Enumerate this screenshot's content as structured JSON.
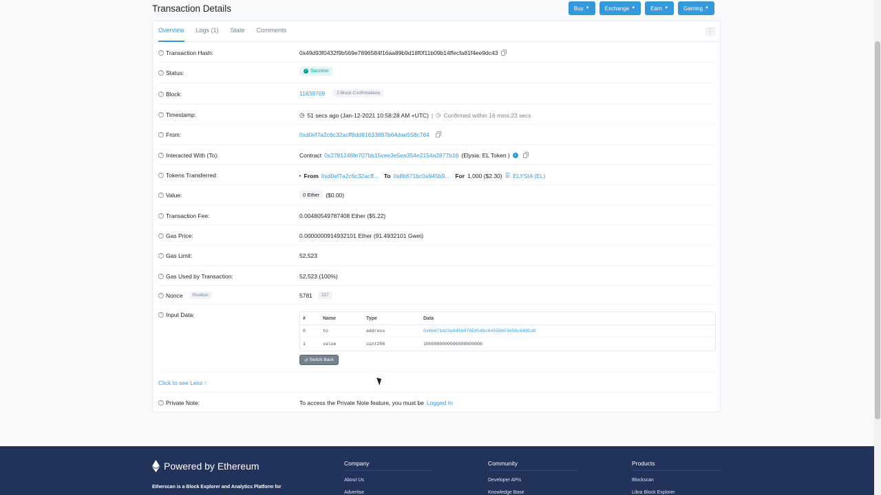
{
  "page_title": "Transaction Details",
  "top_buttons": [
    {
      "label": "Buy"
    },
    {
      "label": "Exchange"
    },
    {
      "label": "Earn"
    },
    {
      "label": "Gaming"
    }
  ],
  "tabs": [
    {
      "label": "Overview",
      "active": true
    },
    {
      "label": "Logs (1)"
    },
    {
      "label": "State"
    },
    {
      "label": "Comments"
    }
  ],
  "details": {
    "tx_hash": {
      "label": "Transaction Hash:",
      "value": "0x49d93f0432f9b569e7896584f16aa89b9d18f0f11b09b14ffecfa81f4ee9dc43"
    },
    "status": {
      "label": "Status:",
      "value": "Success"
    },
    "block": {
      "label": "Block:",
      "value": "11639709",
      "confirmations": "2 Block Confirmations"
    },
    "timestamp": {
      "label": "Timestamp:",
      "value": "51 secs ago (Jan-12-2021 10:58:28 AM +UTC)",
      "separator": "|",
      "confirmed": "Confirmed within 16 mins:23 secs"
    },
    "from": {
      "label": "From:",
      "value": "0xd0ef7a2c6c32acff8dd81633897b64dae558c764"
    },
    "interacted": {
      "label": "Interacted With (To):",
      "prefix": "Contract",
      "address": "0x2781246fe707bb15cee3e5ea354e2154a2877b16",
      "name": "(Elysia: EL Token )"
    },
    "tokens": {
      "label": "Tokens Transferred:",
      "from_label": "From",
      "from": "0xd0ef7a2c6c32acff...",
      "to_label": "To",
      "to": "0x8b671bc0a945b9...",
      "for_label": "For",
      "amount": "1,000 ($2.30)",
      "token": "ELYSIA (EL)"
    },
    "value": {
      "label": "Value:",
      "amount": "0 Ether",
      "usd": "($0.00)"
    },
    "fee": {
      "label": "Transaction Fee:",
      "value": "0.00480549787408 Ether ($5.22)"
    },
    "gas_price": {
      "label": "Gas Price:",
      "value": "0.0000000914932101 Ether (91.4932101 Gwei)"
    },
    "gas_limit": {
      "label": "Gas Limit:",
      "value": "52,523"
    },
    "gas_used": {
      "label": "Gas Used by Transaction:",
      "value": "52,523 (100%)"
    },
    "nonce": {
      "label": "Nonce",
      "position_label": "Position",
      "value": "5781",
      "position": "227"
    },
    "input_data": {
      "label": "Input Data:",
      "headers": [
        "#",
        "Name",
        "Type",
        "Data"
      ],
      "rows": [
        [
          "0",
          "to",
          "address",
          "0x8b671bC0a9459975E8548c8455D6F3650c58DCd0"
        ],
        [
          "1",
          "value",
          "uint256",
          "1000000000000000000000"
        ]
      ],
      "switch_label": "Switch Back"
    },
    "see_less": "Click to see Less",
    "private_note": {
      "label": "Private Note:",
      "text": "To access the Private Note feature, you must be",
      "link": "Logged In"
    }
  },
  "footer": {
    "powered": "Powered by Ethereum",
    "desc": "Etherscan is a Block Explorer and Analytics Platform for",
    "columns": [
      {
        "title": "Company",
        "items": [
          "About Us",
          "Advertise"
        ]
      },
      {
        "title": "Community",
        "items": [
          "Developer APIs",
          "Knowledge Base"
        ]
      },
      {
        "title": "Products",
        "items": [
          "Blockscan",
          "Libra Block Explorer"
        ]
      }
    ]
  },
  "colors": {
    "accent": "#3498db",
    "success": "#00a186",
    "footer_bg": "#21325b"
  }
}
